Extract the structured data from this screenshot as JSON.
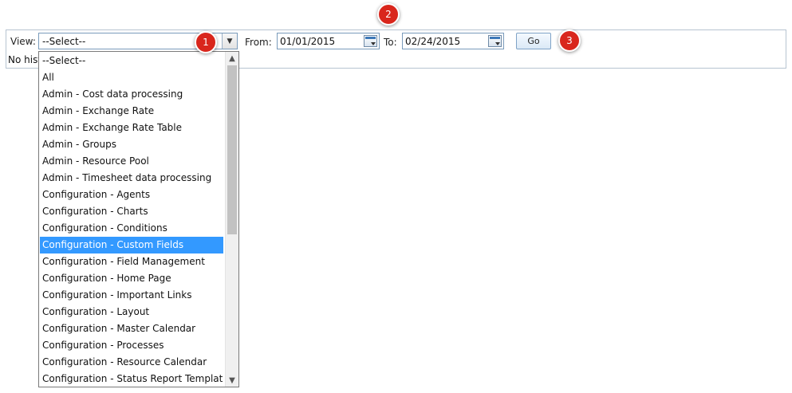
{
  "toolbar": {
    "view_label": "View:",
    "view_selected": "--Select--",
    "from_label": "From:",
    "from_value": "01/01/2015",
    "to_label": "To:",
    "to_value": "02/24/2015",
    "go_label": "Go"
  },
  "status": {
    "text": "No hist"
  },
  "dropdown": {
    "selected_index": 12,
    "options": [
      "--Select--",
      "All",
      "Admin - Cost data processing",
      "Admin - Exchange Rate",
      "Admin - Exchange Rate Table",
      "Admin - Groups",
      "Admin - Resource Pool",
      "Admin - Timesheet data processing",
      "Configuration - Agents",
      "Configuration - Charts",
      "Configuration - Conditions",
      "Configuration - Custom Fields",
      "Configuration - Field Management",
      "Configuration - Home Page",
      "Configuration - Important Links",
      "Configuration - Layout",
      "Configuration - Master Calendar",
      "Configuration - Processes",
      "Configuration - Resource Calendar",
      "Configuration - Status Report Templates"
    ],
    "highlighted": "Configuration - Custom Fields"
  },
  "callouts": [
    "1",
    "2",
    "3"
  ],
  "icons": {
    "select_arrow": "chevron-down-icon",
    "calendar": "calendar-icon",
    "scroll_up": "chevron-up-icon",
    "scroll_down": "chevron-down-icon"
  },
  "colors": {
    "highlight": "#3399ff",
    "callout": "#d9261c",
    "border": "#b7c4d1"
  }
}
